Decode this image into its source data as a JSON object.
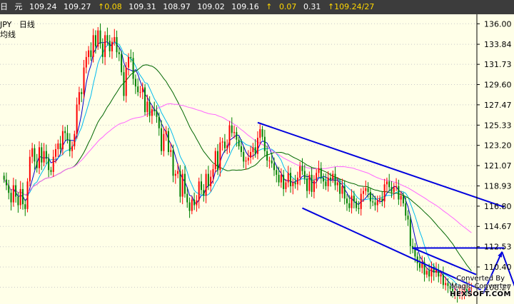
{
  "header": {
    "period_left": "日",
    "unit": "元",
    "open": "109.24",
    "high": "109.27",
    "change_up": "0.08",
    "low": "109.31",
    "v4": "108.97",
    "v5": "109.02",
    "close": "109.16",
    "change2": "0.07",
    "pct": "0.31",
    "date_price": "109.24/27"
  },
  "panel": {
    "symbol": "JPY",
    "period": "日线",
    "line_label": "均线"
  },
  "watermark": {
    "line1": "Converted By",
    "line2": "Magic Converter",
    "line3": "HEXSOFT.COM"
  },
  "chart_data": {
    "type": "line",
    "subtype": "candlestick",
    "y_ticks": [
      136.0,
      133.84,
      131.73,
      129.6,
      127.47,
      125.33,
      123.2,
      121.07,
      118.93,
      116.8,
      114.67,
      112.53,
      110.4,
      108.27
    ],
    "ylim": [
      106.5,
      137.0
    ],
    "grid": true,
    "close_series": [
      119.6,
      119.0,
      118.2,
      117.2,
      119.0,
      117.8,
      116.9,
      118.6,
      117.0,
      116.5,
      119.4,
      122.0,
      122.9,
      121.5,
      120.8,
      123.0,
      121.4,
      122.6,
      121.8,
      120.6,
      120.4,
      122.0,
      122.8,
      123.4,
      122.8,
      124.7,
      124.5,
      123.8,
      122.6,
      123.1,
      124.4,
      127.5,
      128.8,
      128.6,
      131.4,
      132.5,
      133.2,
      132.5,
      134.8,
      133.6,
      135.3,
      133.9,
      132.5,
      134.8,
      134.2,
      133.1,
      134.1,
      134.6,
      133.0,
      132.8,
      130.9,
      128.4,
      131.4,
      132.5,
      132.4,
      130.2,
      129.4,
      128.8,
      128.8,
      129.3,
      126.7,
      127.8,
      126.3,
      127.0,
      126.8,
      126.2,
      125.0,
      122.6,
      124.4,
      124.7,
      122.5,
      122.7,
      120.0,
      120.2,
      120.5,
      117.8,
      120.2,
      118.1,
      117.2,
      116.3,
      117.5,
      116.9,
      117.4,
      119.4,
      118.5,
      117.9,
      120.2,
      118.9,
      119.9,
      120.7,
      122.6,
      120.6,
      123.5,
      123.6,
      122.9,
      123.2,
      125.3,
      124.5,
      124.6,
      123.8,
      123.1,
      122.5,
      121.5,
      121.6,
      121.9,
      122.5,
      123.0,
      122.3,
      124.0,
      124.9,
      124.1,
      122.6,
      121.6,
      121.6,
      121.3,
      120.6,
      120.1,
      119.3,
      120.1,
      118.6,
      119.3,
      120.3,
      118.9,
      119.3,
      119.1,
      119.8,
      121.0,
      120.5,
      119.7,
      118.4,
      120.1,
      118.3,
      119.5,
      120.3,
      120.8,
      119.8,
      119.4,
      118.9,
      119.8,
      119.6,
      120.2,
      119.0,
      119.3,
      118.1,
      118.9,
      117.6,
      117.1,
      116.6,
      117.9,
      117.3,
      116.6,
      116.5,
      118.1,
      118.4,
      118.7,
      118.3,
      117.3,
      117.2,
      116.9,
      117.4,
      117.6,
      117.3,
      119.1,
      119.4,
      118.8,
      118.3,
      118.8,
      118.9,
      117.5,
      117.9,
      117.1,
      115.8,
      115.4,
      112.6,
      112.3,
      111.5,
      110.8,
      110.3,
      110.9,
      109.6,
      110.0,
      109.4,
      110.4,
      109.8,
      110.1,
      109.4,
      109.6,
      108.5,
      108.7,
      108.4,
      108.1,
      107.7,
      107.7,
      107.5,
      107.6,
      107.8,
      108.1,
      107.8,
      108.2,
      108.2
    ],
    "start_open": 120.0,
    "moving_averages": [
      {
        "name": "MA5",
        "color": "#0000cc",
        "period": 5
      },
      {
        "name": "MA10",
        "color": "#00bbee",
        "period": 10
      },
      {
        "name": "MA30",
        "color": "#006600",
        "period": 30
      },
      {
        "name": "MA60",
        "color": "#ff66ff",
        "period": 60
      }
    ],
    "trend_lines": [
      {
        "from": [
          108,
          125.6
        ],
        "to": [
          213,
          116.7
        ]
      },
      {
        "from": [
          127,
          116.6
        ],
        "to": [
          203,
          108.0
        ]
      },
      {
        "from": [
          174,
          112.4
        ],
        "to": [
          213,
          112.4
        ]
      },
      {
        "from": [
          174,
          112.4
        ],
        "to": [
          201,
          109.6
        ]
      }
    ],
    "forecast_arrows": [
      {
        "from": [
          204,
          107.6
        ],
        "to": [
          212,
          112.0
        ]
      },
      {
        "from": [
          212,
          112.0
        ],
        "to": [
          219,
          107.3
        ]
      }
    ],
    "colors": {
      "up": "#ff0000",
      "down": "#008000",
      "axis": "#000000",
      "grid": "#c8c8c8",
      "trend": "#0000dd"
    }
  }
}
